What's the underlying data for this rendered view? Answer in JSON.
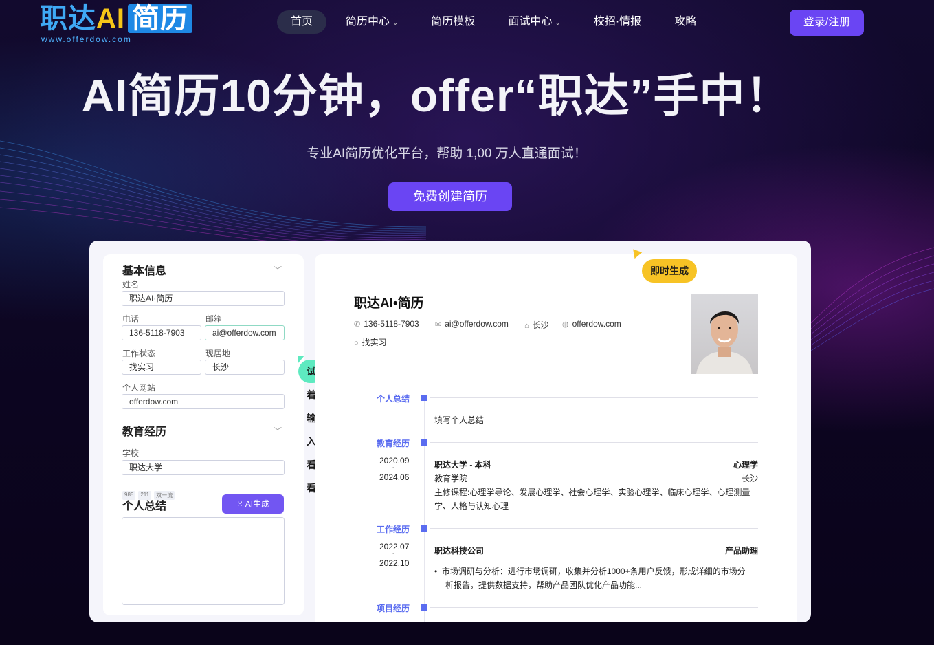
{
  "header": {
    "logo_text_cn": "职达",
    "logo_text_ai": "AI",
    "logo_text_box": "简历",
    "logo_url": "www.offerdow.com",
    "nav": [
      {
        "label": "首页",
        "active": true,
        "has_dropdown": false
      },
      {
        "label": "简历中心",
        "active": false,
        "has_dropdown": true
      },
      {
        "label": "简历模板",
        "active": false,
        "has_dropdown": false
      },
      {
        "label": "面试中心",
        "active": false,
        "has_dropdown": true
      },
      {
        "label": "校招·情报",
        "active": false,
        "has_dropdown": false
      },
      {
        "label": "攻略",
        "active": false,
        "has_dropdown": false
      }
    ],
    "login_label": "登录/注册"
  },
  "hero": {
    "title": "AI简历10分钟，offer“职达”手中！",
    "subtitle": "专业AI简历优化平台，帮助 1,00 万人直通面试！",
    "cta_label": "免费创建简历"
  },
  "form": {
    "basic_title": "基本信息",
    "name_label": "姓名",
    "name_value": "职达AI·简历",
    "phone_label": "电话",
    "phone_value": "136-5118-7903",
    "email_label": "邮箱",
    "email_value": "ai@offerdow.com",
    "status_label": "工作状态",
    "status_value": "找实习",
    "city_label": "现居地",
    "city_value": "长沙",
    "website_label": "个人网站",
    "website_value": "offerdow.com",
    "more": "...",
    "edu_title": "教育经历",
    "school_label": "学校",
    "school_value": "职达大学",
    "school_tags": [
      "985",
      "211",
      "双一流"
    ],
    "summary_title": "个人总结",
    "ai_button": "AI生成",
    "hint_bubble": "试着输入看看"
  },
  "resume": {
    "badge": "即时生成",
    "name": "职达AI•简历",
    "phone": "136-5118-7903",
    "email": "ai@offerdow.com",
    "city": "长沙",
    "website": "offerdow.com",
    "status": "找实习",
    "sections": {
      "summary": "个人总结",
      "education": "教育经历",
      "work": "工作经历",
      "project": "项目经历"
    },
    "summary_text": "填写个人总结",
    "education": {
      "start": "2020.09",
      "dash": "-",
      "end": "2024.06",
      "school_degree": "职达大学 - 本科",
      "major": "心理学",
      "college": "教育学院",
      "city": "长沙",
      "courses_line1": "主修课程:心理学导论、发展心理学、社会心理学、实验心理学、临床心理学、心理测量",
      "courses_line2": "学、人格与认知心理"
    },
    "work": {
      "start": "2022.07",
      "dash": "-",
      "end": "2022.10",
      "company": "职达科技公司",
      "position": "产品助理",
      "bullet_line1": "市场调研与分析：进行市场调研，收集并分析1000+条用户反馈，形成详细的市场分",
      "bullet_line2": "析报告，提供数据支持，帮助产品团队优化产品功能..."
    }
  }
}
